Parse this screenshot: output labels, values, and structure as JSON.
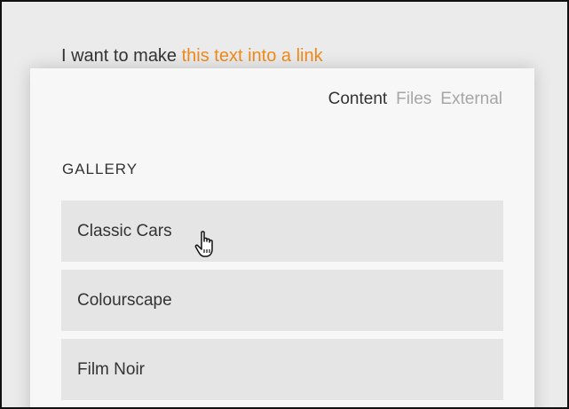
{
  "editor": {
    "text_before": "I want to make ",
    "selected_text": "this text into a link",
    "link_color": "#f08a1c"
  },
  "link_popup": {
    "tabs": [
      {
        "label": "Content",
        "active": true
      },
      {
        "label": "Files",
        "active": false
      },
      {
        "label": "External",
        "active": false
      }
    ],
    "section_heading": "GALLERY",
    "items": [
      {
        "label": "Classic Cars"
      },
      {
        "label": "Colourscape"
      },
      {
        "label": "Film Noir"
      }
    ]
  },
  "cursor": {
    "icon": "hand-pointer-icon"
  }
}
